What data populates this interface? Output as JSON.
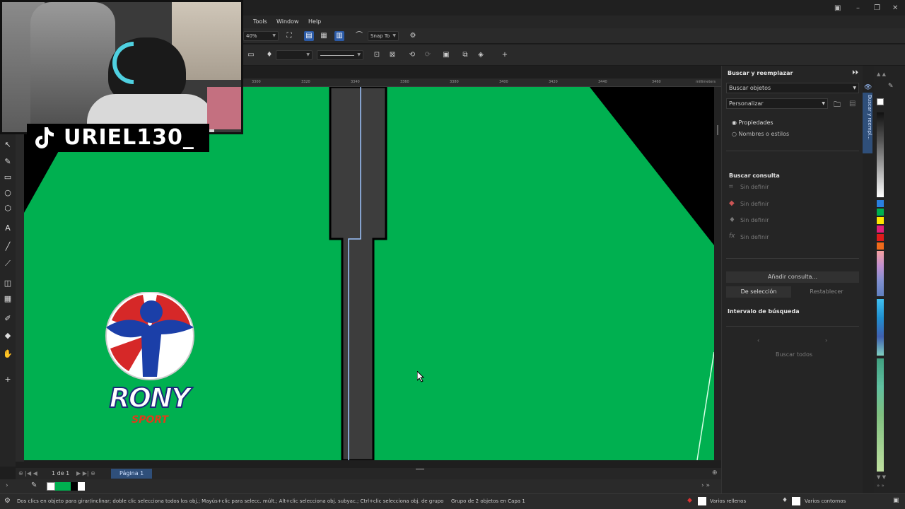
{
  "menu": {
    "tools": "Tools",
    "window": "Window",
    "help": "Help"
  },
  "toolbar": {
    "zoom": "40%",
    "snap_to": "Snap To"
  },
  "ruler": {
    "ticks": [
      "3300",
      "3320",
      "3340",
      "3360",
      "3380",
      "3400",
      "3420",
      "3440",
      "3460"
    ],
    "unit": "millimeters"
  },
  "overlay": {
    "tiktok_name": "URIEL130_",
    "logo_brand": "RONY",
    "logo_sub": "SPORT"
  },
  "pagebar": {
    "page_count": "1 de 1",
    "page_tab": "Página 1"
  },
  "docker": {
    "title": "Buscar y reemplazar",
    "mode_select": "Buscar objetos",
    "custom_select": "Personalizar",
    "radio_props": "Propiedades",
    "radio_names": "Nombres o estilos",
    "query_heading": "Buscar consulta",
    "query_items": [
      "Sin definir",
      "Sin definir",
      "Sin definir",
      "Sin definir"
    ],
    "add_query": "Añadir consulta...",
    "from_selection": "De selección",
    "reset": "Restablecer",
    "range_heading": "Intervalo de búsqueda",
    "find_all": "Buscar todos",
    "side_tab": "Buscar y reempl..."
  },
  "status": {
    "hint": "Dos clics en objeto para girar/inclinar; doble clic selecciona todos los obj.; Mayús+clic para selecc. múlt.; Alt+clic selecciona obj. subyac.; Ctrl+clic selecciona obj. de grupo",
    "selection": "Grupo de 2 objetos en Capa 1",
    "fill": "Varios rellenos",
    "outline": "Varios contornos"
  },
  "colors": {
    "canvas_green": "#00b050",
    "accent_blue": "#2b5aa6"
  }
}
